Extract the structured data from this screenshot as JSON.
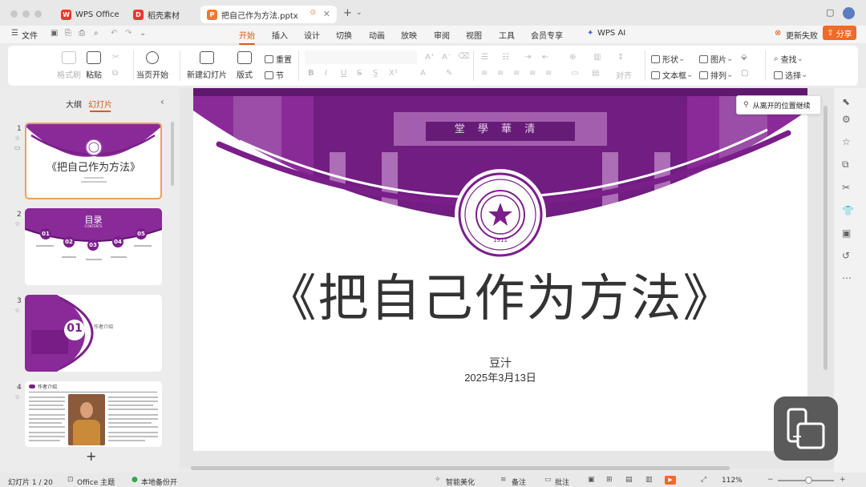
{
  "tabs": {
    "wps_home": "WPS Office",
    "templates": "稻壳素材",
    "document": "把自己作为方法.pptx",
    "new_tab": "+"
  },
  "menu": {
    "file": "文件",
    "items": [
      "开始",
      "插入",
      "设计",
      "切换",
      "动画",
      "放映",
      "审阅",
      "视图",
      "工具",
      "会员专享"
    ],
    "wps_ai": "WPS AI",
    "update_failed": "更新失败",
    "share": "分享"
  },
  "ribbon": {
    "format_painter": "格式刷",
    "paste": "粘贴",
    "play_from_current": "当页开始",
    "new_slide": "新建幻灯片",
    "layout": "版式",
    "reset": "重置",
    "section": "节",
    "shapes": "形状",
    "textbox": "文本框",
    "picture": "图片",
    "arrange": "排列",
    "find": "查找",
    "select": "选择",
    "align": "对齐"
  },
  "left_panel": {
    "outline_tab": "大纲",
    "slides_tab": "幻灯片",
    "slide_numbers": [
      "1",
      "2",
      "3",
      "4"
    ],
    "add": "+",
    "thumb1_title": "《把自己作为方法》",
    "thumb2": {
      "title": "目录",
      "subtitle": "CONTENTS",
      "nums": [
        "01",
        "02",
        "03",
        "04",
        "05"
      ]
    },
    "thumb3": {
      "num": "01",
      "label": "作者介绍"
    },
    "thumb4": {
      "heading": "作者介绍"
    }
  },
  "slide": {
    "title": "《把自己作为方法》",
    "author": "豆汁",
    "date": "2025年3月13日",
    "building_sign": "堂 學 華 清",
    "seal_year": "1911",
    "seal_text": "TSINGHUA UNIVERSITY"
  },
  "resume_tip": "从离开的位置继续",
  "status": {
    "slide_counter": "幻灯片 1 / 20",
    "theme": "Office 主题",
    "backup": "本地备份开",
    "beautify": "智能美化",
    "notes": "备注",
    "comments": "批注",
    "zoom": "112%"
  },
  "colors": {
    "accent": "#e0581a",
    "purple": "#7a1f8a",
    "share_bg": "#f06a28"
  }
}
